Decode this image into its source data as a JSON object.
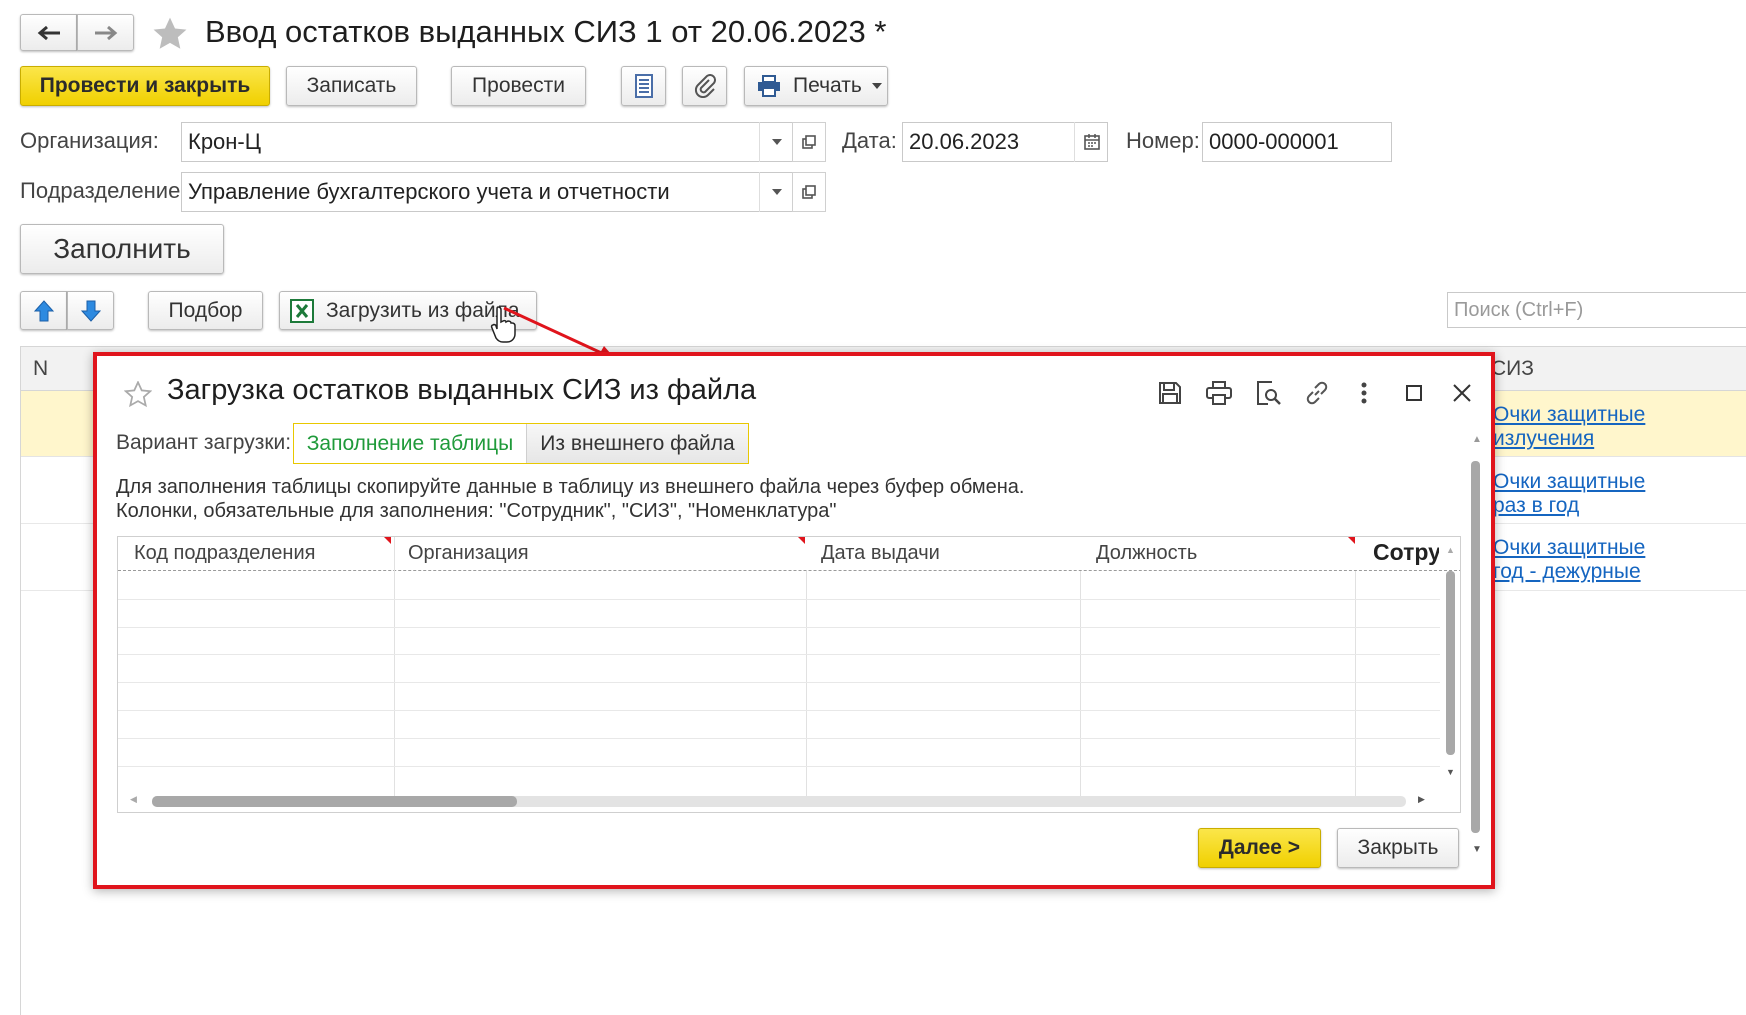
{
  "nav": {
    "back_glyph": "🡐",
    "forward_glyph": "🡒"
  },
  "document": {
    "title": "Ввод остатков выданных СИЗ 1 от 20.06.2023 *"
  },
  "toolbar": {
    "post_close": "Провести и закрыть",
    "save": "Записать",
    "post": "Провести",
    "print": "Печать"
  },
  "form": {
    "org_label": "Организация:",
    "org_value": "Крон-Ц",
    "date_label": "Дата:",
    "date_value": "20.06.2023",
    "number_label": "Номер:",
    "number_value": "0000-000001",
    "dept_label": "Подразделение:",
    "dept_value": "Управление бухгалтерского учета и отчетности",
    "fill_button": "Заполнить"
  },
  "table_toolbar": {
    "pick": "Подбор",
    "load_from_file": "Загрузить из файла",
    "search_placeholder": "Поиск (Ctrl+F)"
  },
  "bg_table": {
    "col_n": "N",
    "col_siz": "СИЗ",
    "links": [
      {
        "line1": "Очки защитные",
        "line2": "излучения"
      },
      {
        "line1": "Очки защитные",
        "line2": "раз в год"
      },
      {
        "line1": "Очки защитные",
        "line2": "год - дежурные"
      }
    ]
  },
  "dialog": {
    "title": "Загрузка остатков выданных СИЗ из файла",
    "variant_label": "Вариант загрузки:",
    "variant_options": [
      "Заполнение таблицы",
      "Из внешнего файла"
    ],
    "variant_selected": "Заполнение таблицы",
    "info_line1": "Для заполнения таблицы скопируйте данные в таблицу из внешнего файла через буфер обмена.",
    "info_line2": "Колонки, обязательные для заполнения: \"Сотрудник\", \"СИЗ\", \"Номенклатура\"",
    "columns": [
      "Код подразделения",
      "Организация",
      "Дата выдачи",
      "Должность",
      "Сотрудник"
    ],
    "next_button": "Далее >",
    "close_button": "Закрыть"
  },
  "colors": {
    "accent_yellow": "#f4d800",
    "highlight_red": "#e0141c",
    "selected_row": "#fff6cc",
    "link": "#1565c0",
    "variant_active": "#1f9a3a"
  }
}
